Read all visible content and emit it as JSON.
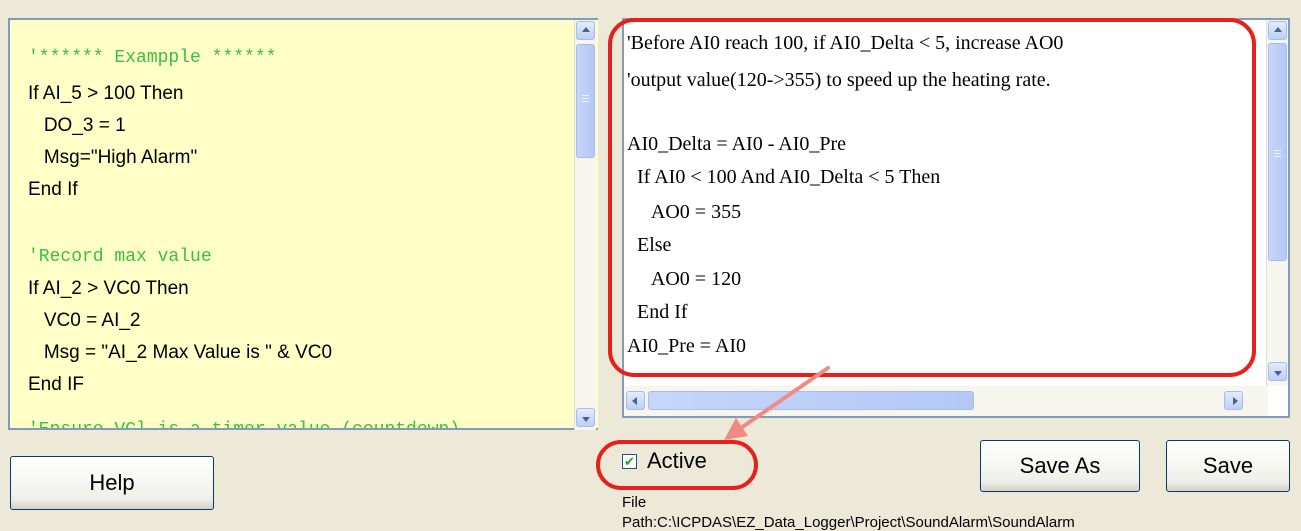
{
  "left_pane": {
    "lines": [
      "'****** Exampple ******",
      "If AI_5 > 100 Then",
      "   DO_3 = 1",
      "   Msg=\"High Alarm\"",
      "End If",
      "",
      "'Record max value",
      "If AI_2 > VC0 Then",
      "   VC0 = AI_2",
      "   Msg = \"AI_2 Max Value is \" & VC0",
      "End IF"
    ],
    "partial_line": "'Ensure VCl is a timer value (countdown)"
  },
  "right_pane": {
    "lines": [
      "'Before AI0 reach 100, if AI0_Delta < 5, increase AO0",
      "'output value(120->355) to speed up the heating rate.",
      "",
      "AI0_Delta = AI0 - AI0_Pre",
      "  If AI0 < 100 And AI0_Delta < 5 Then",
      "     AO0 = 355",
      "  Else",
      "     AO0 = 120",
      "  End If",
      "AI0_Pre = AI0"
    ]
  },
  "controls": {
    "help_label": "Help",
    "active_label": "Active",
    "active_checked": true,
    "save_as_label": "Save As",
    "save_label": "Save",
    "file_label": "File",
    "path_text": "Path:C:\\ICPDAS\\EZ_Data_Logger\\Project\\SoundAlarm\\SoundAlarm"
  },
  "icons": {
    "scroll_up": "arrow-up-icon",
    "scroll_down": "arrow-down-icon",
    "scroll_left": "arrow-left-icon",
    "scroll_right": "arrow-right-icon",
    "checkmark": "checkmark-icon"
  },
  "colors": {
    "background": "#ece9d8",
    "left_pane_bg": "#ffffc8",
    "comment_green": "#3cbf3c",
    "annotation_red": "#e8201c",
    "scroll_blue": "#bccff7"
  }
}
